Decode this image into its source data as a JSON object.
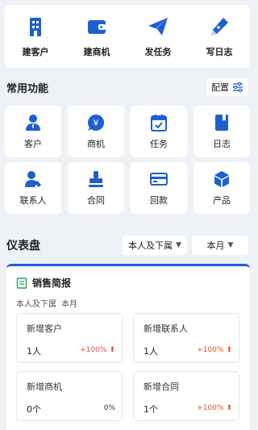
{
  "colors": {
    "primary": "#1d5fd1",
    "accent": "#e2502a",
    "background": "#eef1f6"
  },
  "quick_actions": [
    {
      "label": "建客户",
      "icon": "building-icon"
    },
    {
      "label": "建商机",
      "icon": "wallet-icon"
    },
    {
      "label": "发任务",
      "icon": "paper-plane-icon"
    },
    {
      "label": "写日志",
      "icon": "pen-icon"
    }
  ],
  "common": {
    "title": "常用功能",
    "config_label": "配置",
    "items": [
      {
        "label": "客户",
        "icon": "person-icon"
      },
      {
        "label": "商机",
        "icon": "yen-bubble-icon"
      },
      {
        "label": "任务",
        "icon": "calendar-check-icon"
      },
      {
        "label": "日志",
        "icon": "notebook-icon"
      },
      {
        "label": "联系人",
        "icon": "contact-icon"
      },
      {
        "label": "合同",
        "icon": "stamp-icon"
      },
      {
        "label": "回款",
        "icon": "card-icon"
      },
      {
        "label": "产品",
        "icon": "cube-icon"
      }
    ]
  },
  "dashboard": {
    "title": "仪表盘",
    "scope_select": "本人及下属",
    "period_select": "本月"
  },
  "sales_report": {
    "title": "销售简报",
    "scope": "本人及下属",
    "period": "本月",
    "stats": [
      {
        "name": "新增客户",
        "value": "1人",
        "change": "+100%",
        "up": true
      },
      {
        "name": "新增联系人",
        "value": "1人",
        "change": "+100%",
        "up": true
      },
      {
        "name": "新增商机",
        "value": "0个",
        "change": "0%",
        "up": false
      },
      {
        "name": "新增合同",
        "value": "1个",
        "change": "+100%",
        "up": true
      }
    ]
  }
}
